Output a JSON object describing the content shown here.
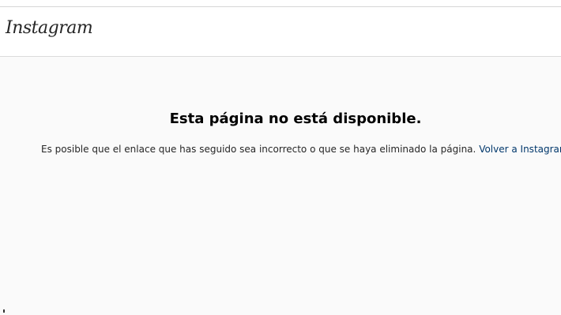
{
  "navbar": {
    "logo_text": "Instagram"
  },
  "error": {
    "title": "Esta página no está disponible.",
    "message": "Es posible que el enlace que has seguido sea incorrecto o que se haya eliminado la página.",
    "link_text": "Volver a Instagram.",
    "link_color": "#00376b"
  }
}
